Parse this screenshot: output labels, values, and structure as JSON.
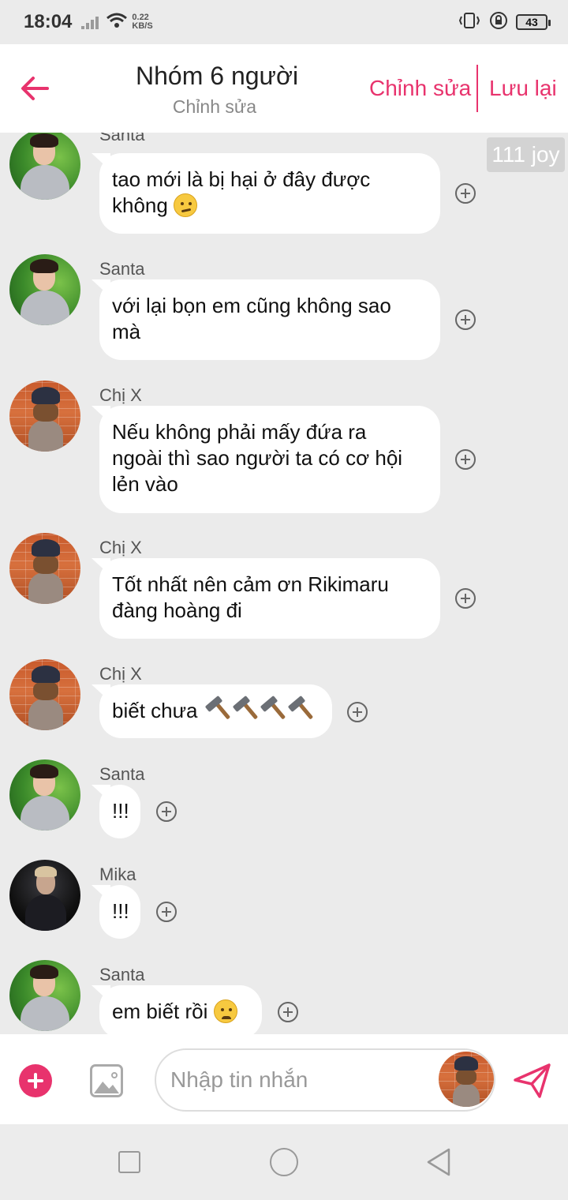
{
  "status_bar": {
    "time": "18:04",
    "net_speed_value": "0.22",
    "net_speed_unit": "KB/S",
    "battery": "43"
  },
  "header": {
    "title": "Nhóm 6 người",
    "subtitle": "Chỉnh sửa",
    "edit_label": "Chỉnh sửa",
    "save_label": "Lưu lại",
    "accent_color": "#e8336d"
  },
  "side_label": "111 joy",
  "messages": [
    {
      "sender": "Santa",
      "lines": [
        "tao mới là bị hại ở đây được",
        "không"
      ],
      "emoji": "smirking-face"
    },
    {
      "sender": "Santa",
      "lines": [
        "với lại bọn em cũng không sao",
        "mà"
      ]
    },
    {
      "sender": "Chị X",
      "lines": [
        "Nếu không phải mấy đứa ra",
        "ngoài thì sao người ta có cơ hội",
        "lẻn vào"
      ]
    },
    {
      "sender": "Chị X",
      "lines": [
        "Tốt nhất nên cảm ơn Rikimaru",
        "đàng hoàng đi"
      ]
    },
    {
      "sender": "Chị X",
      "lines": [
        "biết chưa"
      ],
      "emoji": "hammer x4"
    },
    {
      "sender": "Santa",
      "lines": [
        "!!!"
      ]
    },
    {
      "sender": "Mika",
      "lines": [
        "!!!"
      ]
    },
    {
      "sender": "Santa",
      "lines": [
        "em biết rồi"
      ],
      "emoji": "slightly-frowning-face"
    }
  ],
  "input": {
    "placeholder": "Nhập tin nhắn"
  },
  "icons": {
    "back": "arrow-left-icon",
    "add": "plus-circle-icon",
    "image": "image-icon",
    "send": "paper-plane-icon",
    "reaction": "add-reaction-icon"
  }
}
